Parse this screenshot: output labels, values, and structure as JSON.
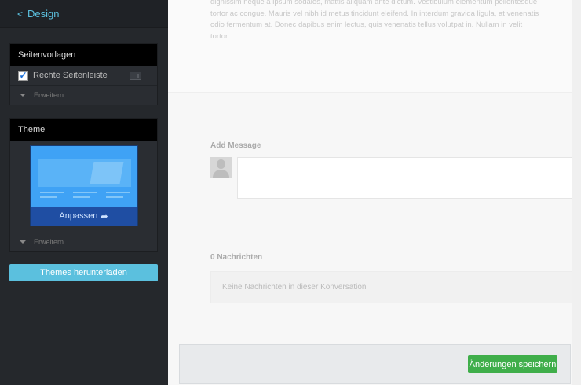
{
  "sidebar": {
    "back_label": "Design",
    "layouts_panel": {
      "title": "Seitenvorlagen",
      "option_label": "Rechte Seitenleiste",
      "option_checked": true,
      "expand_label": "Erweitern"
    },
    "theme_panel": {
      "title": "Theme",
      "customize_label": "Anpassen",
      "expand_label": "Erweitern"
    },
    "download_button": "Themes herunterladen"
  },
  "main": {
    "lorem_text": "dignissim neque a ipsum sodales, mattis aliquam ante dictum. Vestibulum elementum pellentesque tortor ac congue. Mauris vel nibh id metus tincidunt eleifend. In interdum gravida ligula, at venenatis odio fermentum at. Donec dapibus enim lectus, quis venenatis tellus volutpat in. Nullam in velit tortor.",
    "add_message_label": "Add Message",
    "messages_count_label": "0 Nachrichten",
    "empty_state": "Keine Nachrichten in dieser Konversation",
    "save_button": "Änderungen speichern"
  },
  "colors": {
    "accent": "#5bc0de",
    "save": "#3fae4a",
    "sidebar_bg": "#25282c"
  }
}
